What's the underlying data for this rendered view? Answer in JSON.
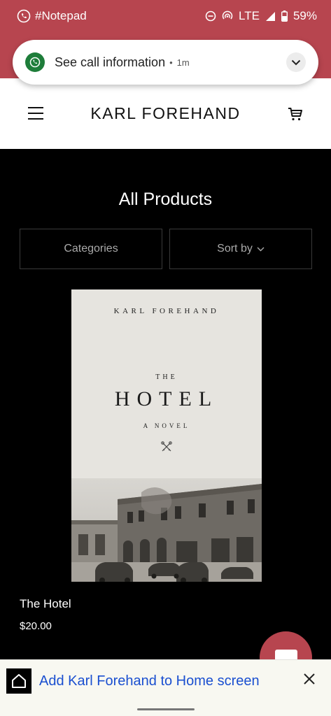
{
  "status": {
    "app_label": "#Notepad",
    "network": "LTE",
    "battery": "59%"
  },
  "notification": {
    "title": "See call information",
    "separator": "•",
    "time": "1m"
  },
  "header": {
    "brand": "KARL FOREHAND"
  },
  "main": {
    "heading": "All Products",
    "filters": {
      "categories_label": "Categories",
      "sort_label": "Sort by"
    },
    "product": {
      "cover": {
        "author": "KARL FOREHAND",
        "the": "THE",
        "title": "HOTEL",
        "subtitle": "A NOVEL"
      },
      "name": "The Hotel",
      "price": "$20.00"
    }
  },
  "add_to_home": {
    "label": "Add Karl Forehand to Home screen"
  },
  "colors": {
    "accent": "#b7454f",
    "link": "#1a4fd0",
    "background": "#000000",
    "whatsapp": "#1e7d3a"
  }
}
